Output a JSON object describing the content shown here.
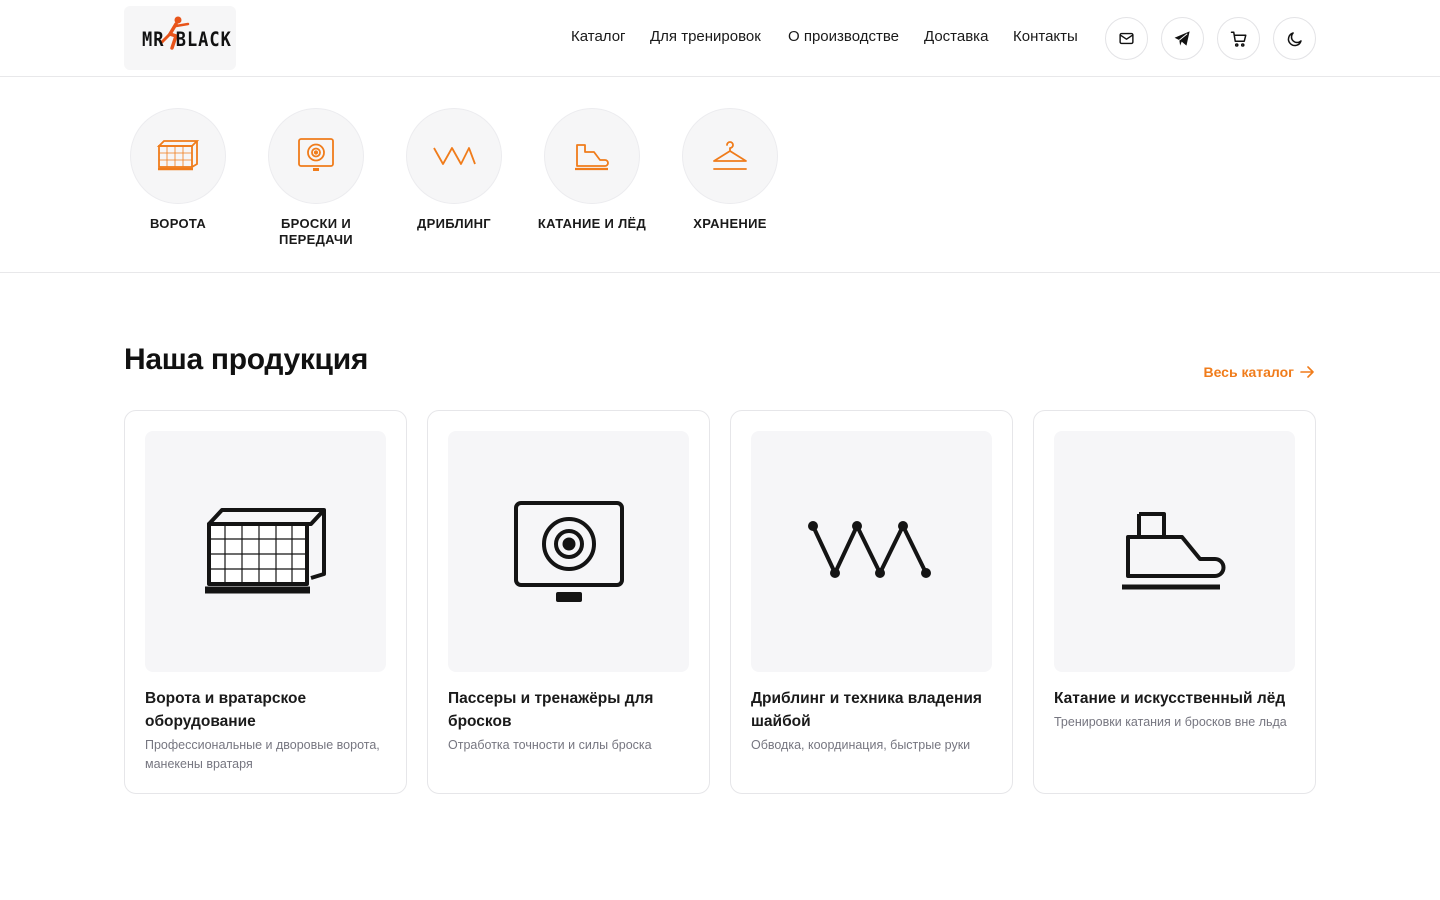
{
  "brand": {
    "logo_text": "MR BLACK",
    "accent": "#f07c1b"
  },
  "nav": {
    "items": [
      {
        "label": "Каталог"
      },
      {
        "label": "Для тренировок"
      },
      {
        "label": "О производстве"
      },
      {
        "label": "Доставка"
      },
      {
        "label": "Контакты"
      }
    ],
    "icons": [
      "mail-icon",
      "telegram-icon",
      "cart-icon",
      "moon-icon"
    ]
  },
  "categories": [
    {
      "label": "ВОРОТА",
      "icon": "goal-net-icon"
    },
    {
      "label": "БРОСКИ И ПЕРЕДАЧИ",
      "icon": "target-icon"
    },
    {
      "label": "ДРИБЛИНГ",
      "icon": "zigzag-icon"
    },
    {
      "label": "КАТАНИЕ И ЛЁД",
      "icon": "skate-icon"
    },
    {
      "label": "ХРАНЕНИЕ",
      "icon": "hanger-icon"
    }
  ],
  "products": {
    "title": "Наша продукция",
    "all_link": "Весь каталог",
    "cards": [
      {
        "title": "Ворота и вратарское оборудование",
        "desc": "Профессиональные и дворовые ворота, манекены вратаря",
        "icon": "goal-net-icon"
      },
      {
        "title": "Пассеры и тренажёры для бросков",
        "desc": "Отработка точности и силы броска",
        "icon": "target-icon"
      },
      {
        "title": "Дриблинг и техника владения шайбой",
        "desc": "Обводка, координация, быстрые руки",
        "icon": "zigzag-icon"
      },
      {
        "title": "Катание и искусственный лёд",
        "desc": "Тренировки катания и бросков вне льда",
        "icon": "skate-icon"
      }
    ]
  }
}
